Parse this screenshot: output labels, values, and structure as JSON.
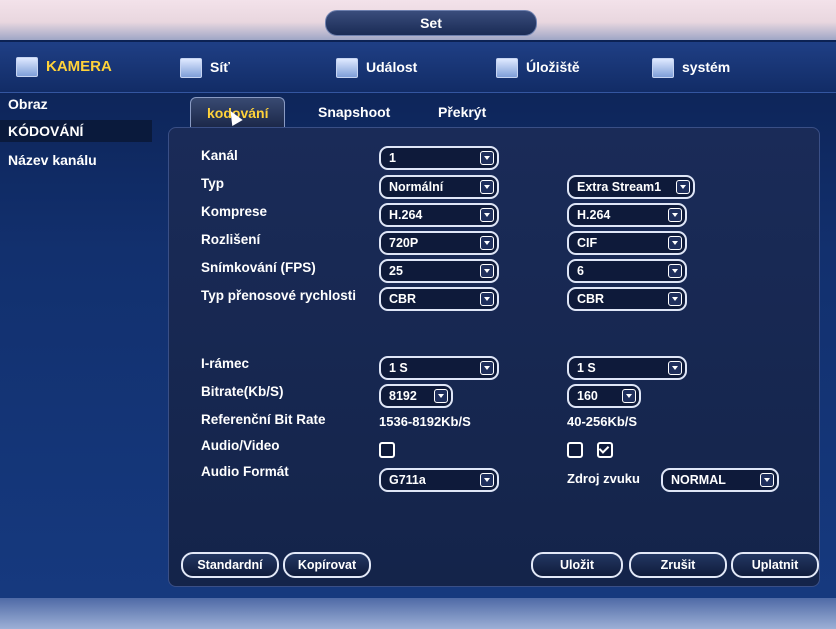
{
  "window": {
    "title": "Set"
  },
  "nav": {
    "items": [
      {
        "label": "KAMERA",
        "icon": "camera-icon",
        "active": true
      },
      {
        "label": "Síť",
        "icon": "network-icon"
      },
      {
        "label": "Událost",
        "icon": "event-icon"
      },
      {
        "label": "Úložiště",
        "icon": "storage-icon"
      },
      {
        "label": "systém",
        "icon": "system-icon"
      }
    ]
  },
  "sidebar": {
    "items": [
      {
        "label": "Obraz"
      },
      {
        "label": "KÓDOVÁNÍ",
        "active": true
      },
      {
        "label": "Název kanálu"
      }
    ]
  },
  "subtabs": [
    {
      "label": "kodování",
      "active": true
    },
    {
      "label": "Snapshoot"
    },
    {
      "label": "Překrýt"
    }
  ],
  "form": {
    "channel": {
      "label": "Kanál",
      "value": "1"
    },
    "type": {
      "label": "Typ",
      "main": "Normální",
      "extra": "Extra Stream1"
    },
    "compression": {
      "label": "Komprese",
      "main": "H.264",
      "extra": "H.264"
    },
    "resolution": {
      "label": "Rozlišení",
      "main": "720P",
      "extra": "CIF"
    },
    "fps": {
      "label": "Snímkování (FPS)",
      "main": "25",
      "extra": "6"
    },
    "bitrate_type": {
      "label": "Typ přenosové rychlosti",
      "main": "CBR",
      "extra": "CBR"
    },
    "iframe": {
      "label": "I-rámec",
      "main": "1 S",
      "extra": "1 S"
    },
    "bitrate": {
      "label": "Bitrate(Kb/S)",
      "main": "8192",
      "extra": "160"
    },
    "ref_bitrate": {
      "label": "Referenční Bit Rate",
      "main": "1536-8192Kb/S",
      "extra": "40-256Kb/S"
    },
    "audio_video": {
      "label": "Audio/Video",
      "main_checked": false,
      "extra_audio_checked": false,
      "extra_video_checked": true
    },
    "audio_format": {
      "label": "Audio Formát",
      "main": "G711a",
      "source_label": "Zdroj zvuku",
      "source": "NORMAL"
    }
  },
  "buttons": {
    "default": "Standardní",
    "copy": "Kopírovat",
    "save": "Uložit",
    "cancel": "Zrušit",
    "apply": "Uplatnit"
  },
  "colors": {
    "active_text": "#ffd23a",
    "background": "#12306e"
  }
}
